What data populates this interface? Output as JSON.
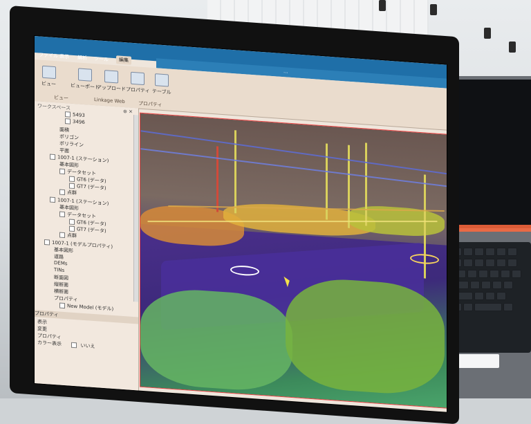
{
  "app": {
    "title_bar": "...",
    "menu": [
      "ファイル",
      "表示",
      "解析",
      "ツール",
      "編集"
    ],
    "ribbon": {
      "buttons": [
        {
          "label": "ビュー"
        },
        {
          "label": "ビューポート"
        },
        {
          "label": "アップロード"
        },
        {
          "label": "プロパティ"
        },
        {
          "label": "テーブル"
        }
      ],
      "groups": [
        "ビュー",
        "Linkage Web",
        "プロパティ"
      ]
    },
    "workspace": {
      "title": "ワークスペース",
      "items": [
        "5493",
        "3496",
        "面積",
        "ポリゴン",
        "ポリライン",
        "平面",
        "1007-1 (ステーション)",
        "基本図形",
        "データセット",
        "GT6 (データ)",
        "GT7 (データ)",
        "点群",
        "1007-1 (ステーション)",
        "基本図形",
        "データセット",
        "GT6 (データ)",
        "GT7 (データ)",
        "点群",
        "1007-1 (モデルプロパティ)",
        "基本図形",
        "道路",
        "DEMs",
        "TINs",
        "断面図",
        "縦断面",
        "横断面",
        "プロパティ",
        "New Model (モデル)"
      ]
    },
    "properties": {
      "title": "プロパティ",
      "rows": [
        {
          "label": "表示"
        },
        {
          "label": "変更"
        },
        {
          "label": "プロパティ"
        },
        {
          "label": "カラー表示",
          "value": "いいえ"
        }
      ]
    }
  },
  "colors": {
    "ribbon_blue": "#1f6fa8",
    "viewport_border": "#e44",
    "point_cloud_green": "#4aa46b",
    "point_cloud_purple": "#4a2f9c"
  }
}
